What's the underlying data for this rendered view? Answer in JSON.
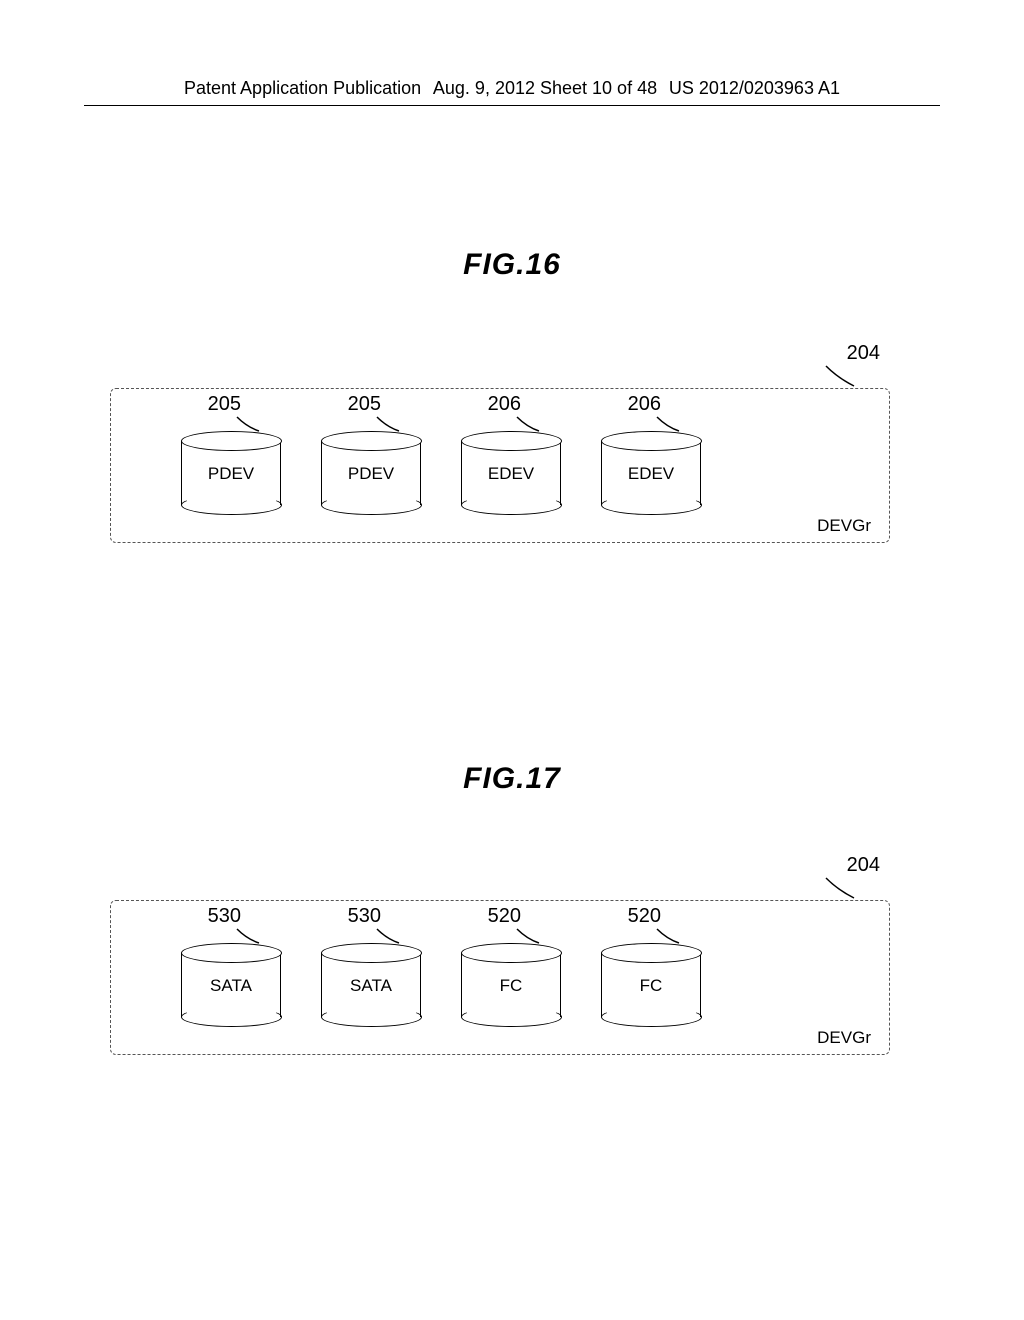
{
  "header": {
    "left": "Patent Application Publication",
    "mid": "Aug. 9, 2012  Sheet 10 of 48",
    "right": "US 2012/0203963 A1"
  },
  "fig16": {
    "caption": "FIG.16",
    "group_ref": "204",
    "group_label": "DEVGr",
    "cyls": [
      {
        "ref": "205",
        "label": "PDEV"
      },
      {
        "ref": "205",
        "label": "PDEV"
      },
      {
        "ref": "206",
        "label": "EDEV"
      },
      {
        "ref": "206",
        "label": "EDEV"
      }
    ]
  },
  "fig17": {
    "caption": "FIG.17",
    "group_ref": "204",
    "group_label": "DEVGr",
    "cyls": [
      {
        "ref": "530",
        "label": "SATA"
      },
      {
        "ref": "530",
        "label": "SATA"
      },
      {
        "ref": "520",
        "label": "FC"
      },
      {
        "ref": "520",
        "label": "FC"
      }
    ]
  }
}
